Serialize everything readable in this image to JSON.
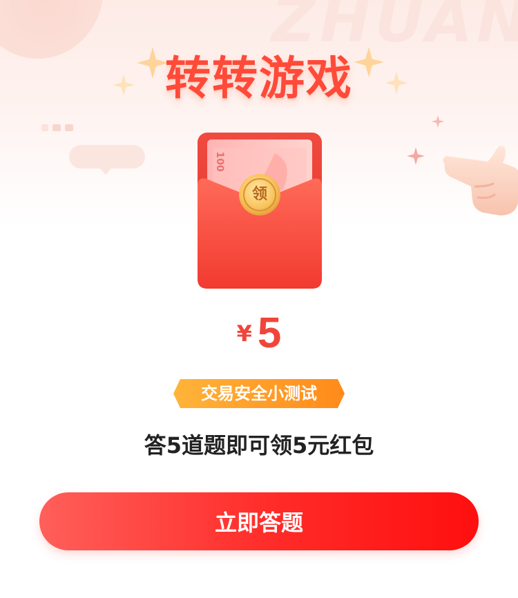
{
  "header": {
    "title": "转转游戏",
    "watermark": "ZHUAN"
  },
  "envelope": {
    "coin_label": "领",
    "banknote_denomination": "100"
  },
  "reward": {
    "currency_symbol": "¥",
    "amount": "5"
  },
  "badge": {
    "label": "交易安全小测试"
  },
  "description": "答5道题即可领5元红包",
  "cta": {
    "label": "立即答题"
  },
  "colors": {
    "accent": "#ff4a3a",
    "button_start": "#ff5f5a",
    "button_end": "#ff0f0f",
    "badge_start": "#ffb23a",
    "badge_end": "#ff8a1a"
  }
}
